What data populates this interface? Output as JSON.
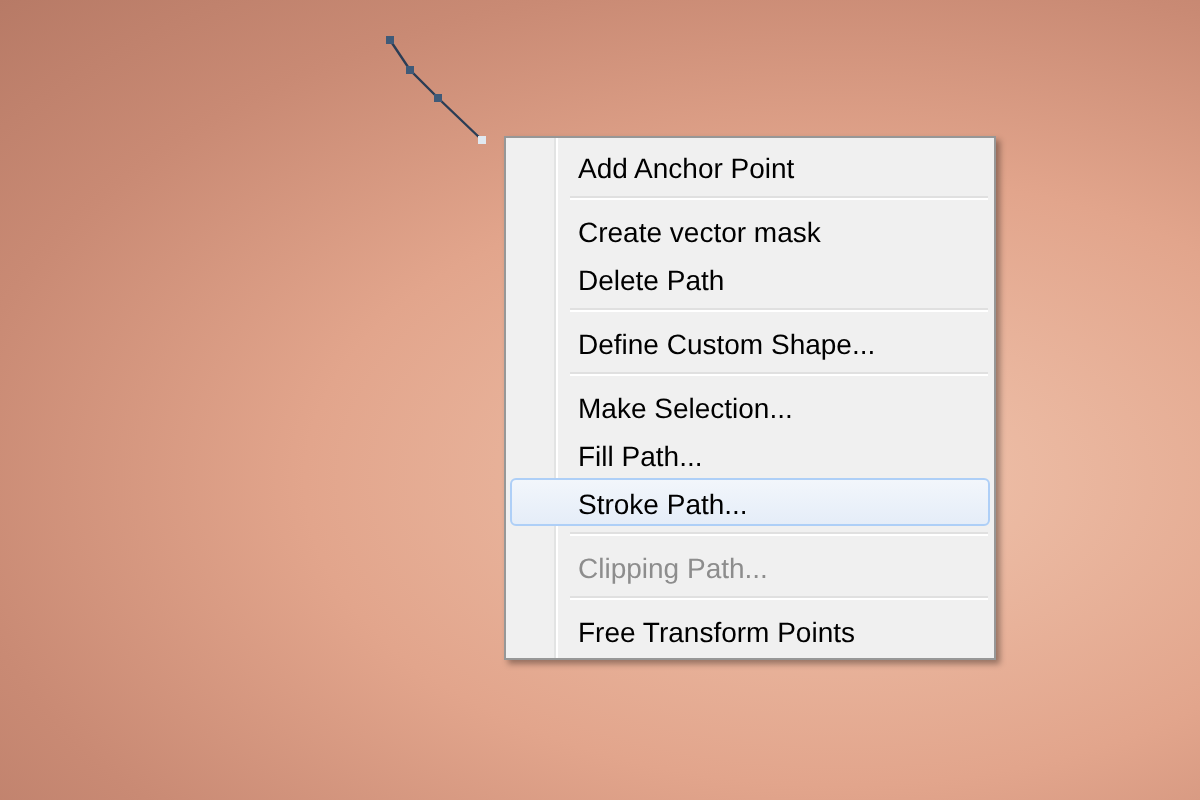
{
  "context_menu": {
    "items": [
      {
        "kind": "item",
        "label": "Add Anchor Point",
        "disabled": false,
        "selected": false
      },
      {
        "kind": "separator"
      },
      {
        "kind": "item",
        "label": "Create vector mask",
        "disabled": false,
        "selected": false
      },
      {
        "kind": "item",
        "label": "Delete Path",
        "disabled": false,
        "selected": false
      },
      {
        "kind": "separator"
      },
      {
        "kind": "item",
        "label": "Define Custom Shape...",
        "disabled": false,
        "selected": false
      },
      {
        "kind": "separator"
      },
      {
        "kind": "item",
        "label": "Make Selection...",
        "disabled": false,
        "selected": false
      },
      {
        "kind": "item",
        "label": "Fill Path...",
        "disabled": false,
        "selected": false
      },
      {
        "kind": "item",
        "label": "Stroke Path...",
        "disabled": false,
        "selected": true
      },
      {
        "kind": "separator"
      },
      {
        "kind": "item",
        "label": "Clipping Path...",
        "disabled": true,
        "selected": false
      },
      {
        "kind": "separator"
      },
      {
        "kind": "item",
        "label": "Free Transform Points",
        "disabled": false,
        "selected": false
      }
    ]
  }
}
